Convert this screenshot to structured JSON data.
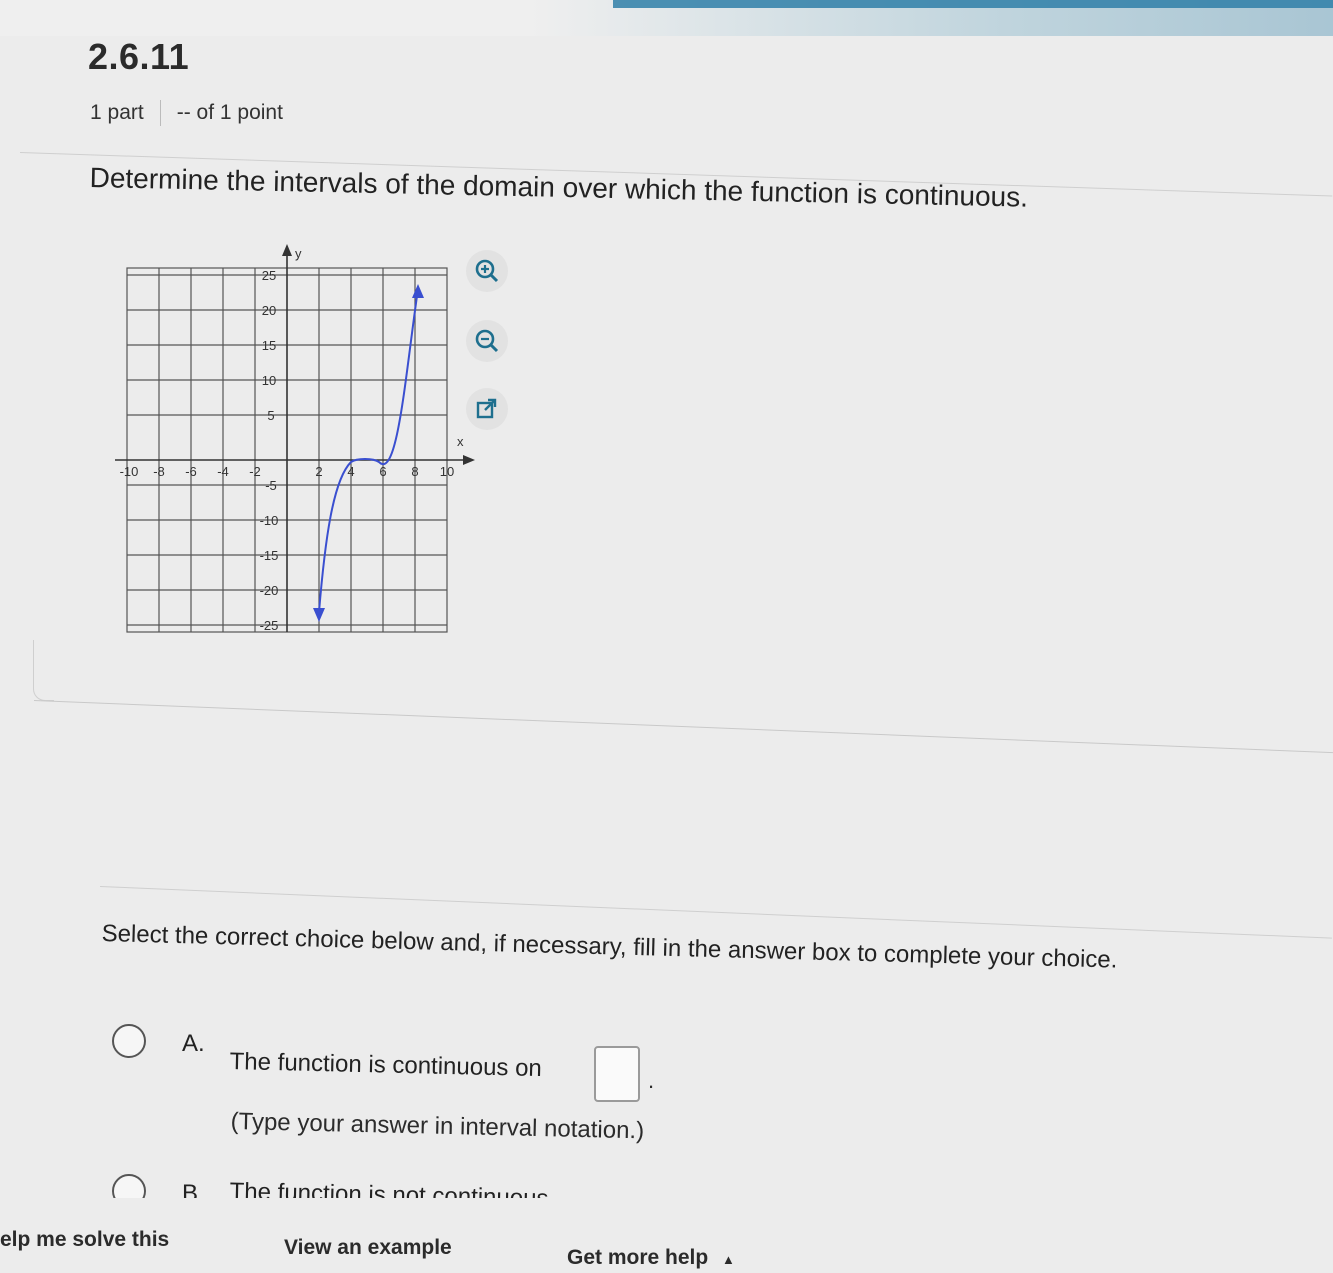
{
  "question": {
    "number": "2.6.11",
    "parts": "1 part",
    "points": "-- of 1 point",
    "prompt": "Determine the intervals of the domain over which the function is continuous."
  },
  "graph": {
    "x_axis_label": "x",
    "y_axis_label": "y",
    "x_ticks": [
      "-10",
      "-8",
      "-6",
      "-4",
      "-2",
      "2",
      "4",
      "6",
      "8",
      "10"
    ],
    "y_ticks": [
      "25",
      "20",
      "15",
      "10",
      "5",
      "-5",
      "-10",
      "-15",
      "-20",
      "-25"
    ],
    "curve_color": "#3a4fd0"
  },
  "tools": {
    "zoom_in": "zoom-in-icon",
    "zoom_out": "zoom-out-icon",
    "popout": "external-link-icon"
  },
  "instructions": "Select the correct choice below and, if necessary, fill in the answer box to complete your choice.",
  "choices": {
    "a_letter": "A.",
    "a_text": "The function is continuous on",
    "a_hint": "(Type your answer in interval notation.)",
    "b_letter": "B.",
    "b_text": "The function is not continuous"
  },
  "footer": {
    "help_solve": "elp me solve this",
    "view_example": "View an example",
    "more_help": "Get more help",
    "more_help_icon": "▲"
  }
}
